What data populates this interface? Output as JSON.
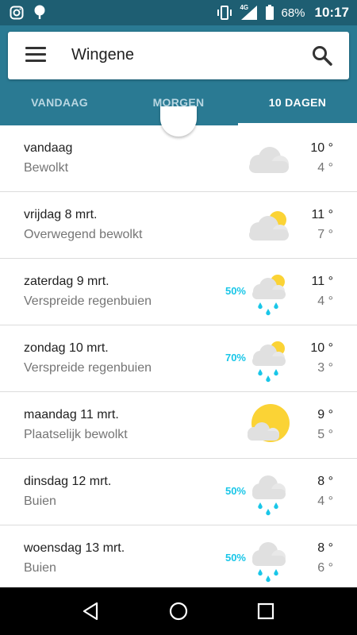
{
  "status_bar": {
    "battery": "68%",
    "time": "10:17",
    "network": "4G",
    "icons": [
      "instagram-icon",
      "location-pin-icon",
      "vibrate-icon",
      "signal-icon",
      "battery-icon"
    ]
  },
  "header": {
    "location": "Wingene",
    "tabs": [
      {
        "label": "VANDAAG",
        "active": false
      },
      {
        "label": "MORGEN",
        "active": false
      },
      {
        "label": "10 DAGEN",
        "active": true
      }
    ]
  },
  "colors": {
    "header": "#2a7a93",
    "status_bar": "#1e5e72",
    "precip": "#19c6e8",
    "sun": "#fbd335",
    "cloud": "#e0e0e0"
  },
  "forecast": [
    {
      "day": "vandaag",
      "condition": "Bewolkt",
      "precip": "",
      "high": "10 °",
      "low": "4 °",
      "icon": "cloudy-icon"
    },
    {
      "day": "vrijdag 8 mrt.",
      "condition": "Overwegend bewolkt",
      "precip": "",
      "high": "11 °",
      "low": "7 °",
      "icon": "mostly-cloudy-icon"
    },
    {
      "day": "zaterdag 9 mrt.",
      "condition": "Verspreide regenbuien",
      "precip": "50%",
      "high": "11 °",
      "low": "4 °",
      "icon": "scattered-showers-icon"
    },
    {
      "day": "zondag 10 mrt.",
      "condition": "Verspreide regenbuien",
      "precip": "70%",
      "high": "10 °",
      "low": "3 °",
      "icon": "scattered-showers-icon"
    },
    {
      "day": "maandag 11 mrt.",
      "condition": "Plaatselijk bewolkt",
      "precip": "",
      "high": "9 °",
      "low": "5 °",
      "icon": "partly-cloudy-icon"
    },
    {
      "day": "dinsdag 12 mrt.",
      "condition": "Buien",
      "precip": "50%",
      "high": "8 °",
      "low": "4 °",
      "icon": "showers-icon"
    },
    {
      "day": "woensdag 13 mrt.",
      "condition": "Buien",
      "precip": "50%",
      "high": "8 °",
      "low": "6 °",
      "icon": "showers-icon"
    }
  ],
  "nav": [
    "back-icon",
    "home-icon",
    "recents-icon"
  ]
}
